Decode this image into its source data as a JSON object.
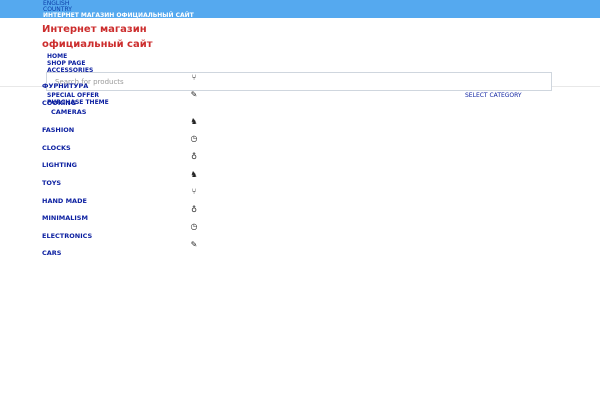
{
  "topbar": {
    "language": "ENGLISH",
    "country": "COUNTRY",
    "site_title": "ИНТЕРНЕТ МАГАЗИН ОФИЦИАЛЬНЫЙ САЙТ"
  },
  "logo": {
    "line1": "Интернет магазин",
    "line2": "официальный сайт"
  },
  "topnav": {
    "items": [
      "HOME",
      "SHOP PAGE",
      "ACCESSORIES"
    ]
  },
  "search": {
    "placeholder": "Search for products",
    "category_label": "SELECT CATEGORY"
  },
  "menu": {
    "special_offer": "SPECIAL OFFER",
    "purchase_theme": "PURCHASE THEME"
  },
  "categories": [
    {
      "label": "ФУРНИТУРА",
      "icon": "chair-icon"
    },
    {
      "label": "COOKING",
      "icon": "pen-icon"
    },
    {
      "label": "CAMERAS",
      "icon": ""
    },
    {
      "label": "FASHION",
      "icon": "horse-icon"
    },
    {
      "label": "CLOCKS",
      "icon": "clock-icon"
    },
    {
      "label": "LIGHTING",
      "icon": "lightbulb-icon"
    },
    {
      "label": "TOYS",
      "icon": "horse-icon"
    },
    {
      "label": "HAND MADE",
      "icon": "chair-icon"
    },
    {
      "label": "MINIMALISM",
      "icon": "lightbulb-icon"
    },
    {
      "label": "ELECTRONICS",
      "icon": "clock-icon"
    },
    {
      "label": "CARS",
      "icon": "pen-icon"
    }
  ],
  "colors": {
    "topbar": "#55a9ef",
    "logo": "#cc2d2d",
    "link": "#0b1fa0"
  }
}
